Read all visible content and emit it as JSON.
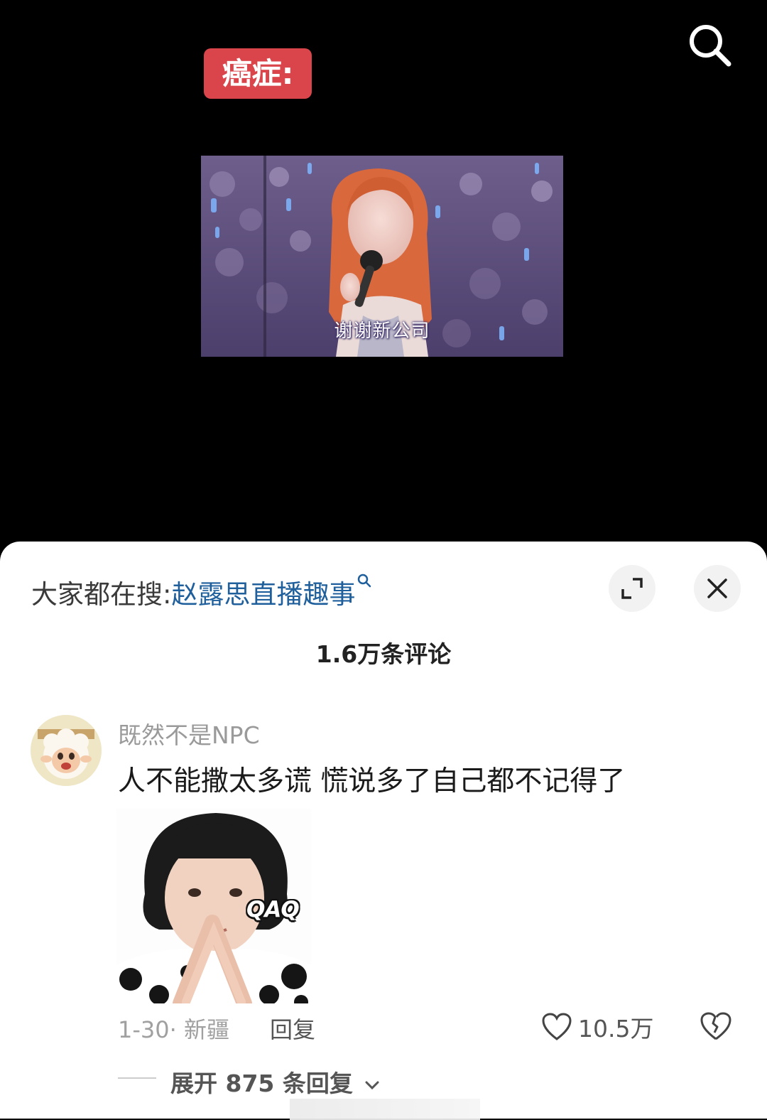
{
  "video": {
    "label": "癌症:",
    "subtitle": "谢谢新公司"
  },
  "sheet": {
    "search_prefix": "大家都在搜:",
    "search_term": "赵露思直播趣事",
    "comment_count": "1.6万条评论"
  },
  "comment": {
    "username": "既然不是NPC",
    "text": "人不能撒太多谎 慌说多了自己都不记得了",
    "sticker_tag": "QAQ",
    "meta": "1-30· 新疆",
    "reply_label": "回复",
    "likes": "10.5万",
    "expand_replies": "展开 875 条回复"
  },
  "colors": {
    "label_bg": "#d9454b",
    "search_link": "#1f5f9c"
  },
  "icons": [
    "search-icon",
    "expand-icon",
    "close-icon",
    "heart-icon",
    "broken-heart-icon",
    "chevron-down-icon",
    "small-search-icon"
  ]
}
